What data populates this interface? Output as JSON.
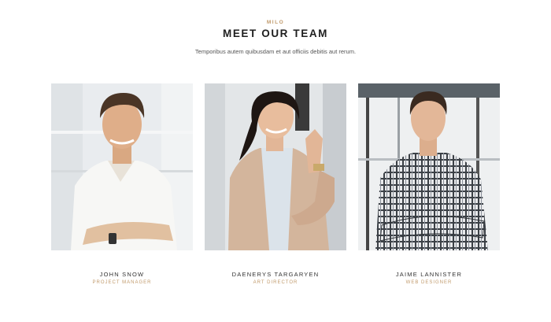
{
  "section": {
    "eyebrow": "MILO",
    "title": "MEET OUR TEAM",
    "subtitle": "Temporibus autem quibusdam et aut officiis debitis aut rerum."
  },
  "team": [
    {
      "name": "JOHN SNOW",
      "role": "PROJECT MANAGER",
      "photo": "man-white-shirt-photo"
    },
    {
      "name": "DAENERYS TARGARYEN",
      "role": "ART DIRECTOR",
      "photo": "woman-beige-blazer-photo"
    },
    {
      "name": "JAIME LANNISTER",
      "role": "WEB DESIGNER",
      "photo": "man-plaid-shirt-photo"
    }
  ],
  "colors": {
    "accent": "#c09a6b",
    "heading": "#1e1e1e",
    "text": "#555555",
    "background": "#ffffff"
  }
}
